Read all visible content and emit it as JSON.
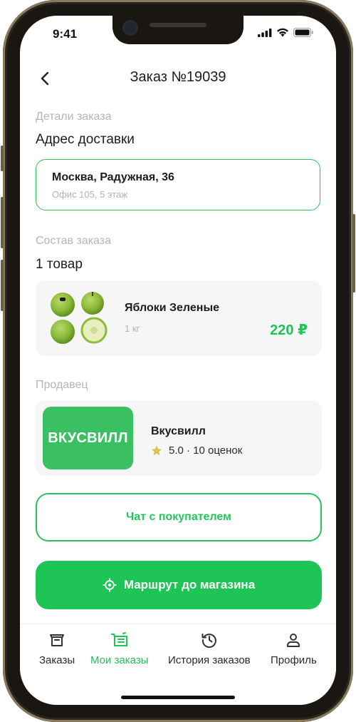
{
  "status": {
    "time": "9:41"
  },
  "header": {
    "title": "Заказ №19039"
  },
  "order_details": {
    "section_label": "Детали заказа",
    "address_title": "Адрес доставки",
    "address_main": "Москва, Радужная, 36",
    "address_sub": "Офис 105, 5 этаж"
  },
  "composition": {
    "section_label": "Состав заказа",
    "count": "1 товар",
    "item": {
      "name": "Яблоки Зеленые",
      "weight": "1 кг",
      "price": "220 ₽"
    }
  },
  "seller": {
    "section_label": "Продавец",
    "logo_text": "ВКУСВИЛЛ",
    "name": "Вкусвилл",
    "rating": "5.0 · 10 оценок"
  },
  "actions": {
    "chat_label": "Чат с покупателем",
    "route_label": "Маршрут до магазина"
  },
  "tabs": [
    {
      "label": "Заказы",
      "icon": "box-icon"
    },
    {
      "label": "Мои заказы",
      "icon": "cart-list-icon",
      "active": true
    },
    {
      "label": "История заказов",
      "icon": "history-icon"
    },
    {
      "label": "Профиль",
      "icon": "person-icon"
    }
  ],
  "colors": {
    "accent": "#1fc456",
    "muted": "#b6b6b6",
    "card": "#f6f6f6"
  }
}
